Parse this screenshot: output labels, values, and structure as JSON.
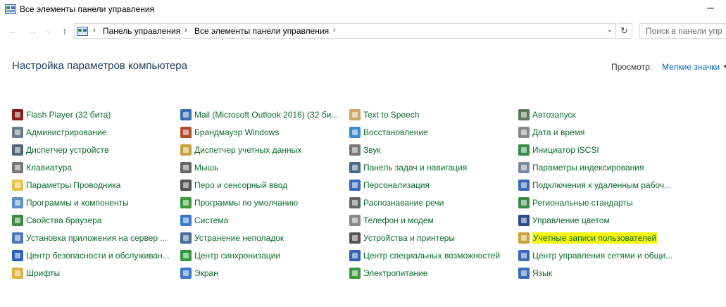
{
  "window": {
    "title": "Все элементы панели управления"
  },
  "nav": {
    "back_glyph": "←",
    "forward_glyph": "→",
    "recent_glyph": "⌄",
    "up_glyph": "↑",
    "breadcrumb": [
      "Панель управления",
      "Все элементы панели управления"
    ],
    "crumb_sep": "›",
    "refresh_glyph": "↻",
    "search_placeholder": "Поиск в панели упр"
  },
  "header": {
    "title": "Настройка параметров компьютера",
    "view_label": "Просмотр:",
    "view_value": "Мелкие значки",
    "view_drop": "▼"
  },
  "colors": {
    "link": "#0d6a2d",
    "heading": "#1e395b",
    "highlight": "#f4f60f"
  },
  "columns": [
    [
      {
        "label": "Flash Player (32 бита)",
        "icon": "flash-icon",
        "color": "#8b1a1a"
      },
      {
        "label": "Администрирование",
        "icon": "admin-tools-icon",
        "color": "#6b7c8c"
      },
      {
        "label": "Диспетчер устройств",
        "icon": "device-manager-icon",
        "color": "#556677"
      },
      {
        "label": "Клавиатура",
        "icon": "keyboard-icon",
        "color": "#777777"
      },
      {
        "label": "Параметры Проводника",
        "icon": "folder-options-icon",
        "color": "#e8c34a"
      },
      {
        "label": "Программы и компоненты",
        "icon": "programs-icon",
        "color": "#5c8fc7"
      },
      {
        "label": "Свойства браузера",
        "icon": "internet-options-icon",
        "color": "#3c8a3c"
      },
      {
        "label": "Установка приложения на сервер ...",
        "icon": "remote-app-icon",
        "color": "#4a7ab5"
      },
      {
        "label": "Центр безопасности и обслуживан...",
        "icon": "flag-icon",
        "color": "#2a62b8"
      },
      {
        "label": "Шрифты",
        "icon": "fonts-icon",
        "color": "#d9b440"
      }
    ],
    [
      {
        "label": "Mail (Microsoft Outlook 2016) (32 би...",
        "icon": "mail-icon",
        "color": "#3a6fb0"
      },
      {
        "label": "Брандмауэр Windows",
        "icon": "firewall-icon",
        "color": "#b04a2a"
      },
      {
        "label": "Диспетчер учетных данных",
        "icon": "credential-manager-icon",
        "color": "#c9a23a"
      },
      {
        "label": "Мышь",
        "icon": "mouse-icon",
        "color": "#666666"
      },
      {
        "label": "Перо и сенсорный ввод",
        "icon": "pen-icon",
        "color": "#555555"
      },
      {
        "label": "Программы по умолчанию",
        "icon": "default-programs-icon",
        "color": "#3c9a3c"
      },
      {
        "label": "Система",
        "icon": "system-icon",
        "color": "#3a7ac8"
      },
      {
        "label": "Устранение неполадок",
        "icon": "troubleshooting-icon",
        "color": "#4a6a9a"
      },
      {
        "label": "Центр синхронизации",
        "icon": "sync-center-icon",
        "color": "#2e9a3c"
      },
      {
        "label": "Экран",
        "icon": "display-icon",
        "color": "#3a7ac8"
      }
    ],
    [
      {
        "label": "Text to Speech",
        "icon": "speech-icon",
        "color": "#c9a86a"
      },
      {
        "label": "Восстановление",
        "icon": "recovery-icon",
        "color": "#3c8ac8"
      },
      {
        "label": "Звук",
        "icon": "sound-icon",
        "color": "#777777"
      },
      {
        "label": "Панель задач и навигация",
        "icon": "taskbar-icon",
        "color": "#4a6a8a"
      },
      {
        "label": "Персонализация",
        "icon": "personalization-icon",
        "color": "#3a6ab8"
      },
      {
        "label": "Распознавание речи",
        "icon": "microphone-icon",
        "color": "#666666"
      },
      {
        "label": "Телефон и модем",
        "icon": "phone-icon",
        "color": "#888888"
      },
      {
        "label": "Устройства и принтеры",
        "icon": "printer-icon",
        "color": "#555555"
      },
      {
        "label": "Центр специальных возможностей",
        "icon": "ease-of-access-icon",
        "color": "#2a62b8"
      },
      {
        "label": "Электропитание",
        "icon": "power-options-icon",
        "color": "#3c9a3c"
      }
    ],
    [
      {
        "label": "Автозапуск",
        "icon": "autoplay-icon",
        "color": "#5a7a5a"
      },
      {
        "label": "Дата и время",
        "icon": "clock-icon",
        "color": "#888888"
      },
      {
        "label": "Инициатор iSCSI",
        "icon": "iscsi-icon",
        "color": "#3a8a4a"
      },
      {
        "label": "Параметры индексирования",
        "icon": "indexing-icon",
        "color": "#7a8aa0"
      },
      {
        "label": "Подключения к удаленным рабоч...",
        "icon": "remote-desktop-icon",
        "color": "#3a6ab8"
      },
      {
        "label": "Региональные стандарты",
        "icon": "region-icon",
        "color": "#3a8a4a"
      },
      {
        "label": "Управление цветом",
        "icon": "color-management-icon",
        "color": "#2a4a8a"
      },
      {
        "label": "Учетные записи пользователей",
        "icon": "user-accounts-icon",
        "color": "#c9a23a",
        "highlighted": true
      },
      {
        "label": "Центр управления сетями и общи...",
        "icon": "network-icon",
        "color": "#3a6ab8"
      },
      {
        "label": "Язык",
        "icon": "language-icon",
        "color": "#3a6ab8"
      }
    ]
  ]
}
